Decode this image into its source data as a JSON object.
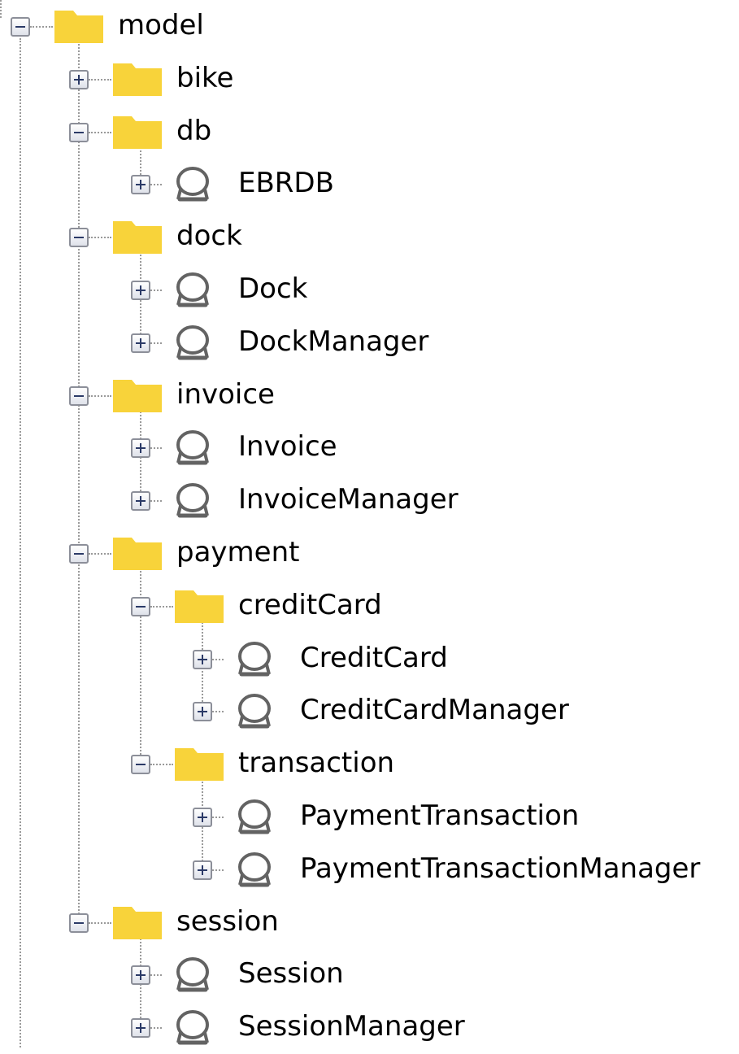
{
  "tree": {
    "top_label": "model",
    "nodes": [
      {
        "label": "model",
        "kind": "folder",
        "depth": 0,
        "toggle": "minus"
      },
      {
        "label": "bike",
        "kind": "folder",
        "depth": 1,
        "toggle": "plus"
      },
      {
        "label": "db",
        "kind": "folder",
        "depth": 1,
        "toggle": "minus"
      },
      {
        "label": "EBRDB",
        "kind": "interface",
        "depth": 2,
        "toggle": "plus"
      },
      {
        "label": "dock",
        "kind": "folder",
        "depth": 1,
        "toggle": "minus"
      },
      {
        "label": "Dock",
        "kind": "interface",
        "depth": 2,
        "toggle": "plus"
      },
      {
        "label": "DockManager",
        "kind": "interface",
        "depth": 2,
        "toggle": "plus"
      },
      {
        "label": "invoice",
        "kind": "folder",
        "depth": 1,
        "toggle": "minus"
      },
      {
        "label": "Invoice",
        "kind": "interface",
        "depth": 2,
        "toggle": "plus"
      },
      {
        "label": "InvoiceManager",
        "kind": "interface",
        "depth": 2,
        "toggle": "plus"
      },
      {
        "label": "payment",
        "kind": "folder",
        "depth": 1,
        "toggle": "minus"
      },
      {
        "label": "creditCard",
        "kind": "folder",
        "depth": 2,
        "toggle": "minus"
      },
      {
        "label": "CreditCard",
        "kind": "interface",
        "depth": 3,
        "toggle": "plus"
      },
      {
        "label": "CreditCardManager",
        "kind": "interface",
        "depth": 3,
        "toggle": "plus"
      },
      {
        "label": "transaction",
        "kind": "folder",
        "depth": 2,
        "toggle": "minus"
      },
      {
        "label": "PaymentTransaction",
        "kind": "interface",
        "depth": 3,
        "toggle": "plus"
      },
      {
        "label": "PaymentTransactionManager",
        "kind": "interface",
        "depth": 3,
        "toggle": "plus"
      },
      {
        "label": "session",
        "kind": "folder",
        "depth": 1,
        "toggle": "minus"
      },
      {
        "label": "Session",
        "kind": "interface",
        "depth": 2,
        "toggle": "plus"
      },
      {
        "label": "SessionManager",
        "kind": "interface",
        "depth": 2,
        "toggle": "plus"
      }
    ],
    "icon_names": {
      "folder": "folder-icon",
      "interface": "interface-icon"
    },
    "colors": {
      "folder": "#f8d33a",
      "interface_stroke": "#636363",
      "toggle_border": "#8c8f99",
      "toggle_mark": "#2b3a67",
      "connector": "#9a9a9a"
    }
  }
}
